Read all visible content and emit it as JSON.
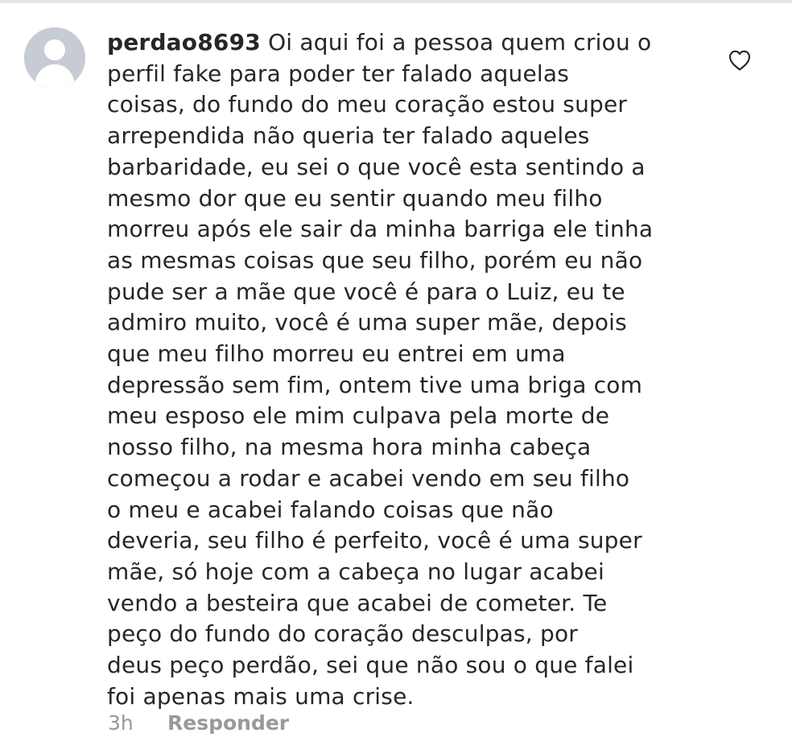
{
  "comment": {
    "username": "perdao8693",
    "text": "Oi aqui foi a pessoa quem criou o\nperfil fake para poder ter falado aquelas\ncoisas, do fundo do meu coração estou super\narrependida não queria ter falado aqueles\nbarbaridade, eu sei o que você esta sentindo a\nmesmo dor que eu sentir quando meu filho\nmorreu após ele sair da minha barriga ele tinha\nas mesmas coisas que seu filho, porém eu não\npude ser a mãe que você é para o Luiz, eu te\nadmiro muito, você é uma super mãe, depois\nque meu filho morreu eu entrei em uma\ndepressão sem fim, ontem tive uma briga com\nmeu esposo ele mim culpava pela morte de\nnosso filho, na mesma hora minha cabeça\ncomeçou a rodar e acabei vendo em seu filho\no meu e acabei falando coisas que não\ndeveria, seu filho é perfeito, você é uma super\nmãe, só hoje com a cabeça no lugar acabei\nvendo a besteira que acabei de cometer. Te\npeço do fundo do coração desculpas, por\ndeus peço perdão, sei que não sou o que falei\nfoi apenas mais uma crise.",
    "timestamp": "3h",
    "reply_label": "Responder"
  },
  "icons": {
    "avatar": "default-avatar-icon",
    "like": "heart-outline-icon"
  },
  "colors": {
    "text": "#262626",
    "secondary_text": "#999999",
    "avatar_background": "#c7ccd4",
    "avatar_silhouette": "#ffffff",
    "divider": "#e4e4e4"
  }
}
